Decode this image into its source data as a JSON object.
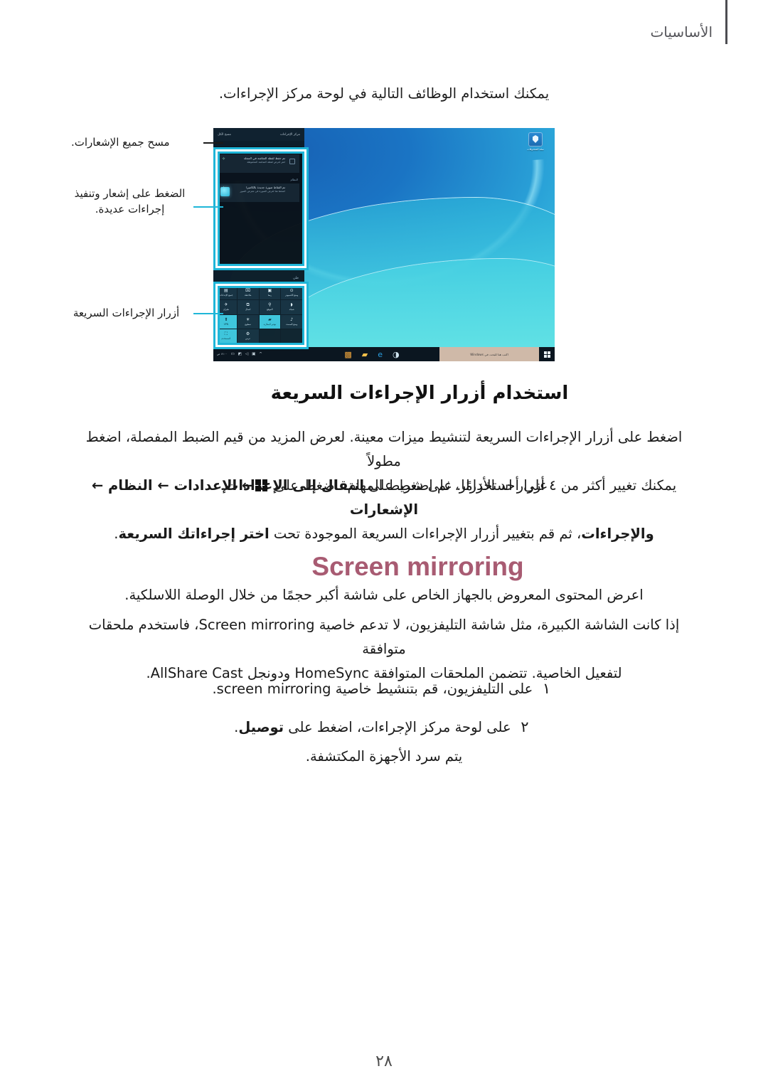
{
  "header": {
    "chapter_title": "الأساسيات"
  },
  "intro": {
    "text": "يمكنك استخدام الوظائف التالية في لوحة مركز الإجراءات."
  },
  "figure": {
    "annotations": [
      {
        "id": "clear-all",
        "text": "مسح جميع الإشعارات."
      },
      {
        "id": "press-notification",
        "text": "الضغط على إشعار وتنفيذ إجراءات عديدة."
      },
      {
        "id": "quick-action-buttons",
        "text": "أزرار الإجراءات السريعة"
      }
    ],
    "screenshot": {
      "action_center": {
        "top_bar_left": "مسح الكل",
        "top_bar_right": "مركز الإجراءات",
        "notification_group_1": "تطبيق",
        "notification_1": {
          "title": "تم حفظ لقطة الشاشة في المجلد",
          "subtitle": "انقر لعرض لقطة الشاشة المحفوظة"
        },
        "notification_group_2": "النظام",
        "notification_2": {
          "title": "تم التقاط صورة جديدة بالكاميرا",
          "subtitle": "اضغط هنا لعرض الصورة في معرض الصور"
        },
        "collapse_label": "طي"
      },
      "tiles": [
        {
          "label": "وضع الكمبيوتر",
          "icon": "⊙",
          "on": false
        },
        {
          "label": "ربط",
          "icon": "▣",
          "on": false
        },
        {
          "label": "ملاحظة",
          "icon": "⌧",
          "on": false
        },
        {
          "label": "جميع الإعدادات",
          "icon": "▤",
          "on": false
        },
        {
          "label": "شبكة",
          "icon": "◗",
          "on": false
        },
        {
          "label": "الموقع",
          "icon": "⚲",
          "on": false
        },
        {
          "label": "اتصال",
          "icon": "⧉",
          "on": false
        },
        {
          "label": "طيران",
          "icon": "✈",
          "on": false
        },
        {
          "label": "وضع الصمت",
          "icon": "♪",
          "on": false
        },
        {
          "label": "توفير البطارية",
          "icon": "▰",
          "on": true
        },
        {
          "label": "سطوع",
          "icon": "☀",
          "on": false
        },
        {
          "label": "VPN",
          "icon": "⬆",
          "on": true
        },
        {
          "label": "",
          "icon": "",
          "on": false
        },
        {
          "label": "",
          "icon": "",
          "on": false
        },
        {
          "label": "عرض",
          "icon": "⚙",
          "on": false
        },
        {
          "label": "المستخدم",
          "icon": "⛶",
          "on": true
        }
      ],
      "taskbar": {
        "clock": "‏١٢:٠٠ ص",
        "search_text": "اكتب هنا للبحث في Windows",
        "tray_icons": [
          "▭",
          "◩",
          "◁",
          "⚿",
          "▣",
          "^"
        ],
        "apps": [
          "store-icon",
          "folder-icon",
          "edge-icon",
          "speaker-icon"
        ],
        "start": "windows-start-icon"
      },
      "desktop_icon_label": "سلة المحذوفات"
    }
  },
  "section": {
    "heading": "استخدام أزرار الإجراءات السريعة",
    "paragraph_1_a": "اضغط على أزرار الإجراءات السريعة لتنشيط ميزات معينة. لعرض المزيد من قيم الضبط المفصلة، اضغط مطولاً",
    "paragraph_1_b_pre": "على أحد الأزرار، ثم اضغط على ",
    "paragraph_1_b_bold": "انتقال إلى الإعدادات",
    "paragraph_1_b_post": ".",
    "paragraph_2_a_pre": "يمكنك تغيير أكثر من ٤ أزرار استخدامًا. على شريط المهام، اضغط على ",
    "paragraph_2_a_bold": "← الإعدادات ← النظام ← الإشعارات",
    "paragraph_2_b_bold_1": "والإجراءات",
    "paragraph_2_b_mid": "، ثم قم بتغيير أزرار الإجراءات السريعة الموجودة تحت ",
    "paragraph_2_b_bold_2": "اختر إجراءاتك السريعة",
    "paragraph_2_b_post": "."
  },
  "screen_mirroring": {
    "title": "Screen mirroring",
    "title_color": "#a85b72",
    "intro": "اعرض المحتوى المعروض بالجهاز الخاص على شاشة أكبر حجمًا من خلال الوصلة اللاسلكية.",
    "note_line_1_a": "إذا كانت الشاشة الكبيرة، مثل شاشة التليفزيون، لا تدعم خاصية ",
    "note_line_1_b": "Screen mirroring",
    "note_line_1_c": "، فاستخدم ملحقات متوافقة",
    "note_line_2_a": "لتفعيل الخاصية. تتضمن الملحقات المتوافقة ",
    "note_line_2_b": "HomeSync",
    "note_line_2_c": " ودونجل ",
    "note_line_2_d": "AllShare Cast",
    "note_line_2_e": ".",
    "steps": [
      {
        "num": "١",
        "text_a": "على التليفزيون، قم بتنشيط خاصية ",
        "text_b": "screen mirroring",
        "text_c": "."
      },
      {
        "num": "٢",
        "text_a": "على لوحة مركز الإجراءات، اضغط على ",
        "text_b": "توصيل",
        "text_c": ".",
        "sub": "يتم سرد الأجهزة المكتشفة."
      }
    ]
  },
  "footer": {
    "page_number": "٢٨"
  }
}
